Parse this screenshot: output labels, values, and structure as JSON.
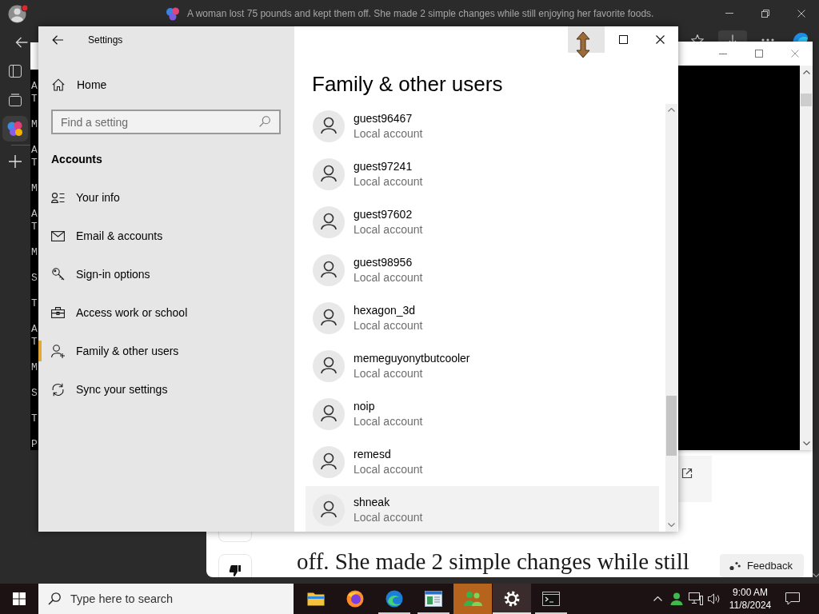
{
  "browser": {
    "tab_title": "A woman lost 75 pounds and kept them off. She made 2 simple changes while still enjoying her favorite foods.",
    "toolbar_buttons": [
      {
        "kind": "favorite",
        "highlighted": false
      },
      {
        "kind": "download",
        "highlighted": true
      },
      {
        "kind": "more",
        "highlighted": false
      },
      {
        "kind": "logo",
        "highlighted": false
      }
    ],
    "sidebar_items": [
      {
        "kind": "tabs",
        "selected": false
      },
      {
        "kind": "collection",
        "selected": false
      },
      {
        "kind": "app",
        "selected": true
      },
      {
        "kind": "add",
        "selected": false
      }
    ],
    "article": {
      "headline": "off. She made 2 simple changes while still"
    },
    "feedback_button": "Feedback"
  },
  "background_console": {
    "line_groups": [
      [
        "A",
        "T"
      ],
      [
        "M"
      ],
      [
        "A",
        "T"
      ],
      [
        "M"
      ],
      [
        "A",
        "T"
      ],
      [
        "M"
      ],
      [
        "S"
      ],
      [
        "T"
      ],
      [
        "A",
        "T"
      ],
      [
        "M"
      ],
      [
        "S"
      ],
      [
        "T"
      ],
      [
        "P"
      ]
    ]
  },
  "settings": {
    "title": "Settings",
    "title_buttons": [
      {
        "kind": "minimize",
        "hovered": true
      },
      {
        "kind": "maximize",
        "hovered": false
      },
      {
        "kind": "close",
        "hovered": false
      }
    ],
    "home": "Home",
    "search": {
      "placeholder": "Find a setting"
    },
    "section": "Accounts",
    "nav_items": [
      {
        "kind": "info",
        "label": "Your info",
        "selected": false
      },
      {
        "kind": "email",
        "label": "Email & accounts",
        "selected": false
      },
      {
        "kind": "key",
        "label": "Sign-in options",
        "selected": false
      },
      {
        "kind": "work",
        "label": "Access work or school",
        "selected": false
      },
      {
        "kind": "family",
        "label": "Family & other users",
        "selected": true
      },
      {
        "kind": "sync",
        "label": "Sync your settings",
        "selected": false
      }
    ],
    "page_title": "Family & other users",
    "users": [
      {
        "name": "guest96467",
        "account_type": "Local account",
        "hovered": false
      },
      {
        "name": "guest97241",
        "account_type": "Local account",
        "hovered": false
      },
      {
        "name": "guest97602",
        "account_type": "Local account",
        "hovered": false
      },
      {
        "name": "guest98956",
        "account_type": "Local account",
        "hovered": false
      },
      {
        "name": "hexagon_3d",
        "account_type": "Local account",
        "hovered": false
      },
      {
        "name": "memeguyonytbutcooler",
        "account_type": "Local account",
        "hovered": false
      },
      {
        "name": "noip",
        "account_type": "Local account",
        "hovered": false
      },
      {
        "name": "remesd",
        "account_type": "Local account",
        "hovered": false
      },
      {
        "name": "shneak",
        "account_type": "Local account",
        "hovered": true
      }
    ]
  },
  "taskbar": {
    "search": {
      "placeholder": "Type here to search"
    },
    "apps": [
      {
        "kind": "folder",
        "running": false,
        "active": false,
        "flashing": false
      },
      {
        "kind": "firefox",
        "running": false,
        "active": false,
        "flashing": false
      },
      {
        "kind": "edge",
        "running": true,
        "active": false,
        "flashing": false
      },
      {
        "kind": "window",
        "running": true,
        "active": false,
        "flashing": false
      },
      {
        "kind": "people",
        "running": false,
        "active": false,
        "flashing": true
      },
      {
        "kind": "settings",
        "running": true,
        "active": true,
        "flashing": false
      },
      {
        "kind": "terminal",
        "running": true,
        "active": false,
        "flashing": false
      }
    ],
    "clock": {
      "time": "9:00 AM",
      "date": "11/8/2024"
    }
  }
}
